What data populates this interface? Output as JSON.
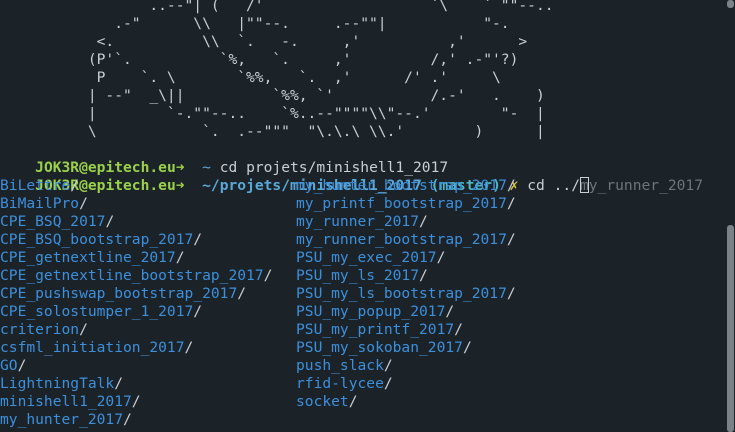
{
  "ascii_art": [
    "                 ..--\"| (   /'                   `\\    ` \"\"--..",
    "             .-\"      \\\\   |\"\"--.     .--\"\"|           \"-.",
    "           <.          \\\\  `.   -.     ,'          ,'      >",
    "          (P'`.          `%,   `.     ,'         /,' .-\"'?)",
    "           P    `. \\       `%%,   `.  ,'      /' .'     \\",
    "          | --\"  _\\||          `%%, `'           /.-'   .    )",
    "          |        `-.\"\"--..    `%..--\"\"\"\"\\\\\"--.'        \"-  |",
    "          \\            `.  .--\"\"\"  \"\\.\\.\\ \\\\.'        )      |"
  ],
  "prompt1": {
    "user": "JOK3R@epitech.eu",
    "arrow": "➜",
    "cwd": "~",
    "command": "cd projets/minishell1_2017"
  },
  "prompt2": {
    "user": "JOK3R@epitech.eu",
    "arrow": "➜",
    "cwd": "~/projets/minishell1_2017",
    "branch": "(master)",
    "dirty": "✗",
    "command": "cd ../",
    "cursor_char": "m",
    "suggestion": "y_runner_2017"
  },
  "listing_left": [
    "BiLettre",
    "BiMailPro",
    "CPE_BSQ_2017",
    "CPE_BSQ_bootstrap_2017",
    "CPE_getnextline_2017",
    "CPE_getnextline_bootstrap_2017",
    "CPE_pushswap_bootstrap_2017",
    "CPE_solostumper_1_2017",
    "criterion",
    "csfml_initiation_2017",
    "GO",
    "LightningTalk",
    "minishell1_2017",
    "my_hunter_2017"
  ],
  "listing_right": [
    "my_hunter_bootstrap_2017",
    "my_printf_bootstrap_2017",
    "my_runner_2017",
    "my_runner_bootstrap_2017",
    "PSU_my_exec_2017",
    "PSU_my_ls_2017",
    "PSU_my_ls_bootstrap_2017",
    "PSU_my_popup_2017",
    "PSU_my_printf_2017",
    "PSU_my_sokoban_2017",
    "push_slack",
    "rfid-lycee",
    "socket"
  ],
  "dir_suffix": "/",
  "colors": {
    "background": "#1b2329",
    "user": "#9bd14a",
    "cwd": "#5aa8d8",
    "branch": "#4fb6c3",
    "dirty": "#d9c33b",
    "directory": "#3d8fdb",
    "suggestion": "#6c757b"
  }
}
